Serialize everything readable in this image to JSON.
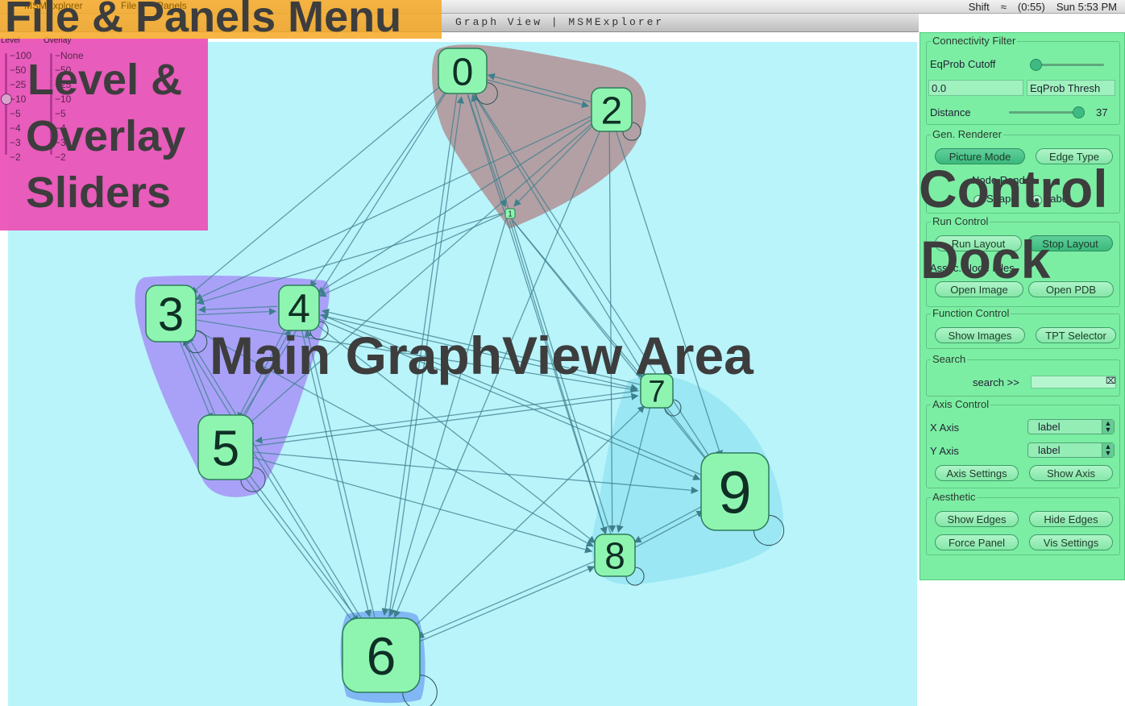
{
  "menubar": {
    "status_items": [
      "Shift",
      "(0:55)",
      "Sun 5:53 PM"
    ]
  },
  "menu_overlay": {
    "app_menu": "MSMExplorer",
    "file_menu": "File",
    "panels_menu": "Panels",
    "annotation": "File & Panels Menu"
  },
  "window": {
    "title": "Graph View | MSMExplorer"
  },
  "sliders": {
    "level_label": "Level",
    "overlay_label": "Overlay",
    "level_ticks": [
      "100",
      "50",
      "25",
      "10",
      "5",
      "4",
      "3",
      "2"
    ],
    "overlay_ticks": [
      "None",
      "50",
      "25",
      "10",
      "5",
      "4",
      "3",
      "2"
    ],
    "level_selected": "10",
    "overlay_selected": "None",
    "annotation_line1": "Level &",
    "annotation_line2": "Overlay",
    "annotation_line3": "Sliders"
  },
  "graph": {
    "annotation": "Main GraphView Area",
    "colors": {
      "background": "#b9f4fb",
      "node_fill": "#8ef5b0",
      "node_stroke": "#2e7d5a",
      "edge": "#3e7f8c",
      "cluster_brown": "#b19b9f",
      "cluster_purple": "#a89cf7",
      "cluster_teal": "#98e5f3",
      "cluster_blue": "#7db3f4"
    },
    "nodes": [
      {
        "id": "0",
        "label": "0"
      },
      {
        "id": "1",
        "label": "1"
      },
      {
        "id": "2",
        "label": "2"
      },
      {
        "id": "3",
        "label": "3"
      },
      {
        "id": "4",
        "label": "4"
      },
      {
        "id": "5",
        "label": "5"
      },
      {
        "id": "6",
        "label": "6"
      },
      {
        "id": "7",
        "label": "7"
      },
      {
        "id": "8",
        "label": "8"
      },
      {
        "id": "9",
        "label": "9"
      }
    ],
    "edges": [
      [
        "0",
        "2"
      ],
      [
        "2",
        "0"
      ],
      [
        "0",
        "1"
      ],
      [
        "2",
        "1"
      ],
      [
        "0",
        "3"
      ],
      [
        "0",
        "4"
      ],
      [
        "0",
        "5"
      ],
      [
        "0",
        "6"
      ],
      [
        "0",
        "7"
      ],
      [
        "0",
        "8"
      ],
      [
        "0",
        "9"
      ],
      [
        "2",
        "3"
      ],
      [
        "2",
        "4"
      ],
      [
        "2",
        "5"
      ],
      [
        "2",
        "6"
      ],
      [
        "2",
        "8"
      ],
      [
        "2",
        "9"
      ],
      [
        "1",
        "3"
      ],
      [
        "1",
        "4"
      ],
      [
        "1",
        "6"
      ],
      [
        "1",
        "7"
      ],
      [
        "1",
        "8"
      ],
      [
        "1",
        "9"
      ],
      [
        "3",
        "4"
      ],
      [
        "4",
        "3"
      ],
      [
        "3",
        "5"
      ],
      [
        "5",
        "3"
      ],
      [
        "4",
        "5"
      ],
      [
        "5",
        "4"
      ],
      [
        "3",
        "7"
      ],
      [
        "3",
        "8"
      ],
      [
        "4",
        "7"
      ],
      [
        "4",
        "8"
      ],
      [
        "4",
        "9"
      ],
      [
        "4",
        "6"
      ],
      [
        "5",
        "7"
      ],
      [
        "5",
        "8"
      ],
      [
        "5",
        "9"
      ],
      [
        "5",
        "6"
      ],
      [
        "6",
        "5"
      ],
      [
        "7",
        "5"
      ],
      [
        "7",
        "4"
      ],
      [
        "7",
        "8"
      ],
      [
        "7",
        "9"
      ],
      [
        "9",
        "8"
      ],
      [
        "8",
        "9"
      ],
      [
        "6",
        "7"
      ],
      [
        "6",
        "8"
      ],
      [
        "8",
        "6"
      ],
      [
        "6",
        "3"
      ],
      [
        "3",
        "6"
      ],
      [
        "6",
        "0"
      ],
      [
        "8",
        "0"
      ],
      [
        "9",
        "4"
      ],
      [
        "6",
        "4"
      ]
    ]
  },
  "dock": {
    "annotation_line1": "Control",
    "annotation_line2": "Dock",
    "connectivity": {
      "title": "Connectivity Filter",
      "eqprob_cutoff": "EqProb Cutoff",
      "eqprob_value": "0.0",
      "eqprob_thresh_placeholder": "EqProb Thresh",
      "distance_label": "Distance",
      "distance_value": "37",
      "eqprob_slider_fraction": 0.0,
      "distance_slider_fraction": 0.88
    },
    "renderer": {
      "title": "Gen. Renderer",
      "picture_mode": "Picture Mode",
      "edge_type": "Edge Type",
      "node_render_title": "Node Render",
      "shape": "Shape",
      "label": "Label"
    },
    "run_control": {
      "title": "Run Control",
      "run_layout": "Run Layout",
      "stop_layout": "Stop Layout",
      "assoc_title": "Assoc. Node Files",
      "open_image": "Open Image",
      "open_pdb": "Open PDB"
    },
    "function_control": {
      "title": "Function Control",
      "show_images": "Show Images",
      "tpt_selector": "TPT Selector"
    },
    "search": {
      "title": "Search",
      "label": "search >>",
      "value": ""
    },
    "axis_control": {
      "title": "Axis Control",
      "x_axis": "X Axis",
      "x_value": "label",
      "y_axis": "Y Axis",
      "y_value": "label",
      "axis_settings": "Axis Settings",
      "show_axis": "Show Axis"
    },
    "aesthetic": {
      "title": "Aesthetic",
      "show_edges": "Show Edges",
      "hide_edges": "Hide Edges",
      "force_panel": "Force Panel",
      "vis_settings": "Vis Settings"
    }
  }
}
